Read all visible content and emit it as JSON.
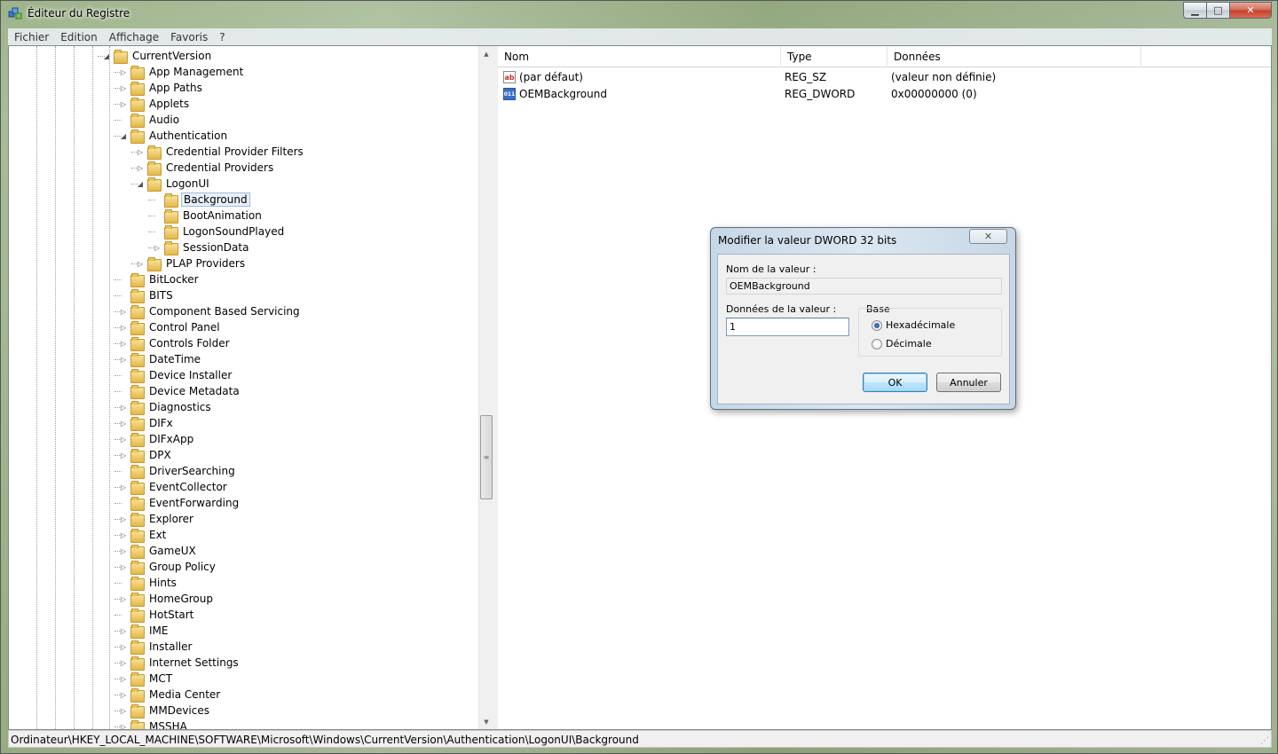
{
  "window": {
    "title": "Éditeur du Registre"
  },
  "menu": [
    "Fichier",
    "Edition",
    "Affichage",
    "Favoris",
    "?"
  ],
  "tree": [
    {
      "label": "CurrentVersion",
      "level": 0,
      "expander": "expanded"
    },
    {
      "label": "App Management",
      "level": 1,
      "expander": "collapsed"
    },
    {
      "label": "App Paths",
      "level": 1,
      "expander": "collapsed"
    },
    {
      "label": "Applets",
      "level": 1,
      "expander": "collapsed"
    },
    {
      "label": "Audio",
      "level": 1,
      "expander": "none"
    },
    {
      "label": "Authentication",
      "level": 1,
      "expander": "expanded"
    },
    {
      "label": "Credential Provider Filters",
      "level": 2,
      "expander": "collapsed"
    },
    {
      "label": "Credential Providers",
      "level": 2,
      "expander": "collapsed"
    },
    {
      "label": "LogonUI",
      "level": 2,
      "expander": "expanded"
    },
    {
      "label": "Background",
      "level": 3,
      "expander": "none",
      "selected": true
    },
    {
      "label": "BootAnimation",
      "level": 3,
      "expander": "none"
    },
    {
      "label": "LogonSoundPlayed",
      "level": 3,
      "expander": "none"
    },
    {
      "label": "SessionData",
      "level": 3,
      "expander": "collapsed"
    },
    {
      "label": "PLAP Providers",
      "level": 2,
      "expander": "collapsed"
    },
    {
      "label": "BitLocker",
      "level": 1,
      "expander": "none"
    },
    {
      "label": "BITS",
      "level": 1,
      "expander": "none"
    },
    {
      "label": "Component Based Servicing",
      "level": 1,
      "expander": "collapsed"
    },
    {
      "label": "Control Panel",
      "level": 1,
      "expander": "collapsed"
    },
    {
      "label": "Controls Folder",
      "level": 1,
      "expander": "collapsed"
    },
    {
      "label": "DateTime",
      "level": 1,
      "expander": "collapsed"
    },
    {
      "label": "Device Installer",
      "level": 1,
      "expander": "none"
    },
    {
      "label": "Device Metadata",
      "level": 1,
      "expander": "none"
    },
    {
      "label": "Diagnostics",
      "level": 1,
      "expander": "collapsed"
    },
    {
      "label": "DIFx",
      "level": 1,
      "expander": "collapsed"
    },
    {
      "label": "DIFxApp",
      "level": 1,
      "expander": "collapsed"
    },
    {
      "label": "DPX",
      "level": 1,
      "expander": "collapsed"
    },
    {
      "label": "DriverSearching",
      "level": 1,
      "expander": "none"
    },
    {
      "label": "EventCollector",
      "level": 1,
      "expander": "collapsed"
    },
    {
      "label": "EventForwarding",
      "level": 1,
      "expander": "none"
    },
    {
      "label": "Explorer",
      "level": 1,
      "expander": "collapsed"
    },
    {
      "label": "Ext",
      "level": 1,
      "expander": "collapsed"
    },
    {
      "label": "GameUX",
      "level": 1,
      "expander": "collapsed"
    },
    {
      "label": "Group Policy",
      "level": 1,
      "expander": "collapsed"
    },
    {
      "label": "Hints",
      "level": 1,
      "expander": "none"
    },
    {
      "label": "HomeGroup",
      "level": 1,
      "expander": "collapsed"
    },
    {
      "label": "HotStart",
      "level": 1,
      "expander": "none"
    },
    {
      "label": "IME",
      "level": 1,
      "expander": "collapsed"
    },
    {
      "label": "Installer",
      "level": 1,
      "expander": "collapsed"
    },
    {
      "label": "Internet Settings",
      "level": 1,
      "expander": "collapsed"
    },
    {
      "label": "MCT",
      "level": 1,
      "expander": "collapsed"
    },
    {
      "label": "Media Center",
      "level": 1,
      "expander": "collapsed"
    },
    {
      "label": "MMDevices",
      "level": 1,
      "expander": "collapsed"
    },
    {
      "label": "MSSHA",
      "level": 1,
      "expander": "collapsed"
    }
  ],
  "list": {
    "columns": [
      "Nom",
      "Type",
      "Données"
    ],
    "rows": [
      {
        "icon": "string-value-icon",
        "name": "(par défaut)",
        "type": "REG_SZ",
        "data": "(valeur non définie)"
      },
      {
        "icon": "binary-value-icon",
        "name": "OEMBackground",
        "type": "REG_DWORD",
        "data": "0x00000000 (0)"
      }
    ]
  },
  "status": {
    "path": "Ordinateur\\HKEY_LOCAL_MACHINE\\SOFTWARE\\Microsoft\\Windows\\CurrentVersion\\Authentication\\LogonUI\\Background"
  },
  "dialog": {
    "title": "Modifier la valeur DWORD 32 bits",
    "name_label": "Nom de la valeur :",
    "name_value": "OEMBackground",
    "data_label": "Données de la valeur :",
    "data_value": "1",
    "base_label": "Base",
    "radio_hex": "Hexadécimale",
    "radio_dec": "Décimale",
    "base_selected": "Hexadécimale",
    "ok": "OK",
    "cancel": "Annuler"
  }
}
